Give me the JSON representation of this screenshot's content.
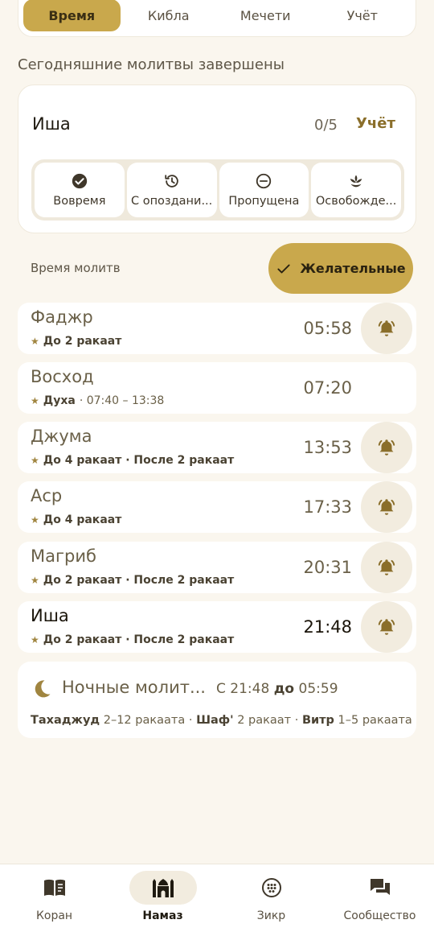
{
  "top_tabs": [
    {
      "label": "Время",
      "active": true
    },
    {
      "label": "Кибла",
      "active": false
    },
    {
      "label": "Мечети",
      "active": false
    },
    {
      "label": "Учёт",
      "active": false
    }
  ],
  "section_title": "Сегодняшние молитвы завершены",
  "current_prayer": {
    "name": "Иша",
    "count": "0/5",
    "stats_link": "Учёт",
    "statuses": [
      {
        "label": "Вовремя",
        "icon": "check-circle-icon"
      },
      {
        "label": "С опоздани...",
        "icon": "history-icon"
      },
      {
        "label": "Пропущена",
        "icon": "minus-circle-icon"
      },
      {
        "label": "Освобожде...",
        "icon": "lotus-icon"
      }
    ]
  },
  "times_label": "Время молитв",
  "preferred_button": "Желательные",
  "prayers": [
    {
      "name": "Фаджр",
      "sub_bold": "До 2 ракаат",
      "sub_rest": "",
      "time": "05:58",
      "bell": true,
      "current": false
    },
    {
      "name": "Восход",
      "sub_bold": "Духа",
      "sub_rest": "· 07:40 – 13:38",
      "time": "07:20",
      "bell": false,
      "current": false
    },
    {
      "name": "Джума",
      "sub_bold": "До 4 ракаат · После 2 ракаат",
      "sub_rest": "",
      "time": "13:53",
      "bell": true,
      "current": false
    },
    {
      "name": "Аср",
      "sub_bold": "До 4 ракаат",
      "sub_rest": "",
      "time": "17:33",
      "bell": true,
      "current": false
    },
    {
      "name": "Магриб",
      "sub_bold": "До 2 ракаат · После 2 ракаат",
      "sub_rest": "",
      "time": "20:31",
      "bell": true,
      "current": false
    },
    {
      "name": "Иша",
      "sub_bold": "До 2 ракаат · После 2 ракаат",
      "sub_rest": "",
      "time": "21:48",
      "bell": true,
      "current": true
    }
  ],
  "night": {
    "title": "Ночные молит...",
    "range_prefix": "С",
    "range_from": "21:48",
    "range_mid": "до",
    "range_to": "05:59",
    "tahajjud_label": "Тахаджуд",
    "tahajjud_value": "2–12 ракаата ·",
    "shaf_label": "Шаф'",
    "shaf_value": "2 ракаат ·",
    "witr_label": "Витр",
    "witr_value": "1–5 ракаата"
  },
  "bottom_nav": [
    {
      "label": "Коран",
      "icon": "book-icon",
      "active": false
    },
    {
      "label": "Намаз",
      "icon": "mosque-icon",
      "active": true
    },
    {
      "label": "Зикр",
      "icon": "tasbih-icon",
      "active": false
    },
    {
      "label": "Сообщество",
      "icon": "chat-icon",
      "active": false
    }
  ],
  "colors": {
    "accent": "#c9a84c",
    "accent_dark": "#8a6e2a",
    "background": "#faf6ee",
    "card": "#ffffff",
    "bell_bg": "#f2ecdf"
  }
}
